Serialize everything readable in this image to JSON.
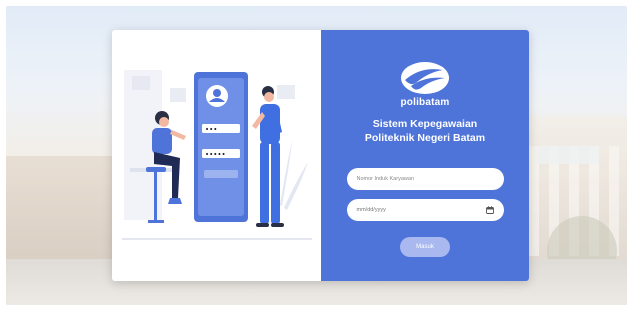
{
  "app": {
    "brand": "polibatam",
    "title_line1": "Sistem Kepegawaian",
    "title_line2": "Politeknik Negeri Batam"
  },
  "form": {
    "nik_placeholder": "Nomor Induk Karyawan",
    "date_placeholder": "mm/dd/yyyy",
    "submit_label": "Masuk"
  },
  "illustration": {
    "password_mask_1": "•••",
    "password_mask_2": "•••••"
  },
  "colors": {
    "panel": "#4f74d9",
    "button": "#a9b9ef",
    "accent_blue": "#3f6fe0"
  },
  "icons": {
    "date_field": "calendar-icon",
    "logo": "polibatam-logo-icon"
  }
}
